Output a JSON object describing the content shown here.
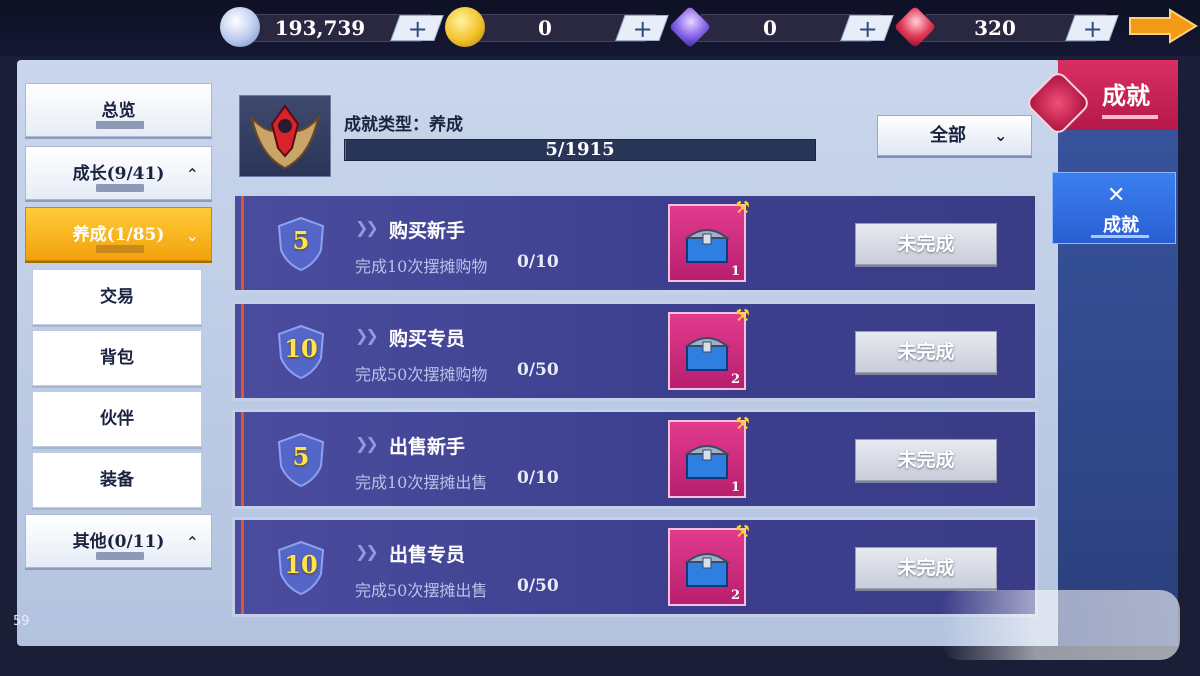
{
  "currencies": [
    {
      "icon": "silver-coin-icon",
      "value": "193,739",
      "plus": "+"
    },
    {
      "icon": "gold-coin-icon",
      "value": "0",
      "plus": "+"
    },
    {
      "icon": "purple-gem-icon",
      "value": "0",
      "plus": "+"
    },
    {
      "icon": "red-gem-icon",
      "value": "320",
      "plus": "+"
    }
  ],
  "sidebar": {
    "overview": {
      "label": "总览"
    },
    "growth": {
      "label": "成长(9/41)",
      "chevron": "^"
    },
    "cultivate": {
      "label": "养成(1/85)",
      "chevron": "v"
    },
    "sub_items": [
      "交易",
      "背包",
      "伙伴",
      "装备"
    ],
    "others": {
      "label": "其他(0/11)",
      "chevron": "^"
    }
  },
  "header": {
    "category_type": "成就类型：养成",
    "progress_text": "5/1915",
    "progress_fraction": 0.0026,
    "filter_label": "全部",
    "filter_chevron": "v"
  },
  "achievements": [
    {
      "level": "5",
      "title": "购买新手",
      "description": "完成10次摆摊购物",
      "progress": "0/10",
      "reward_count": "1",
      "status": "未完成"
    },
    {
      "level": "10",
      "title": "购买专员",
      "description": "完成50次摆摊购物",
      "progress": "0/50",
      "reward_count": "2",
      "status": "未完成"
    },
    {
      "level": "5",
      "title": "出售新手",
      "description": "完成10次摆摊出售",
      "progress": "0/10",
      "reward_count": "1",
      "status": "未完成"
    },
    {
      "level": "10",
      "title": "出售专员",
      "description": "完成50次摆摊出售",
      "progress": "0/50",
      "reward_count": "2",
      "status": "未完成"
    }
  ],
  "right_tabs": {
    "main_label": "成就",
    "side_label": "成就"
  },
  "fps": "59",
  "colors": {
    "accent_active": "#f2a20c",
    "tab_main": "#c92158",
    "tab_side": "#2f6be0",
    "row_bg": "#434596",
    "level_text": "#ffe44c",
    "reward_bg": "#d0307e"
  }
}
